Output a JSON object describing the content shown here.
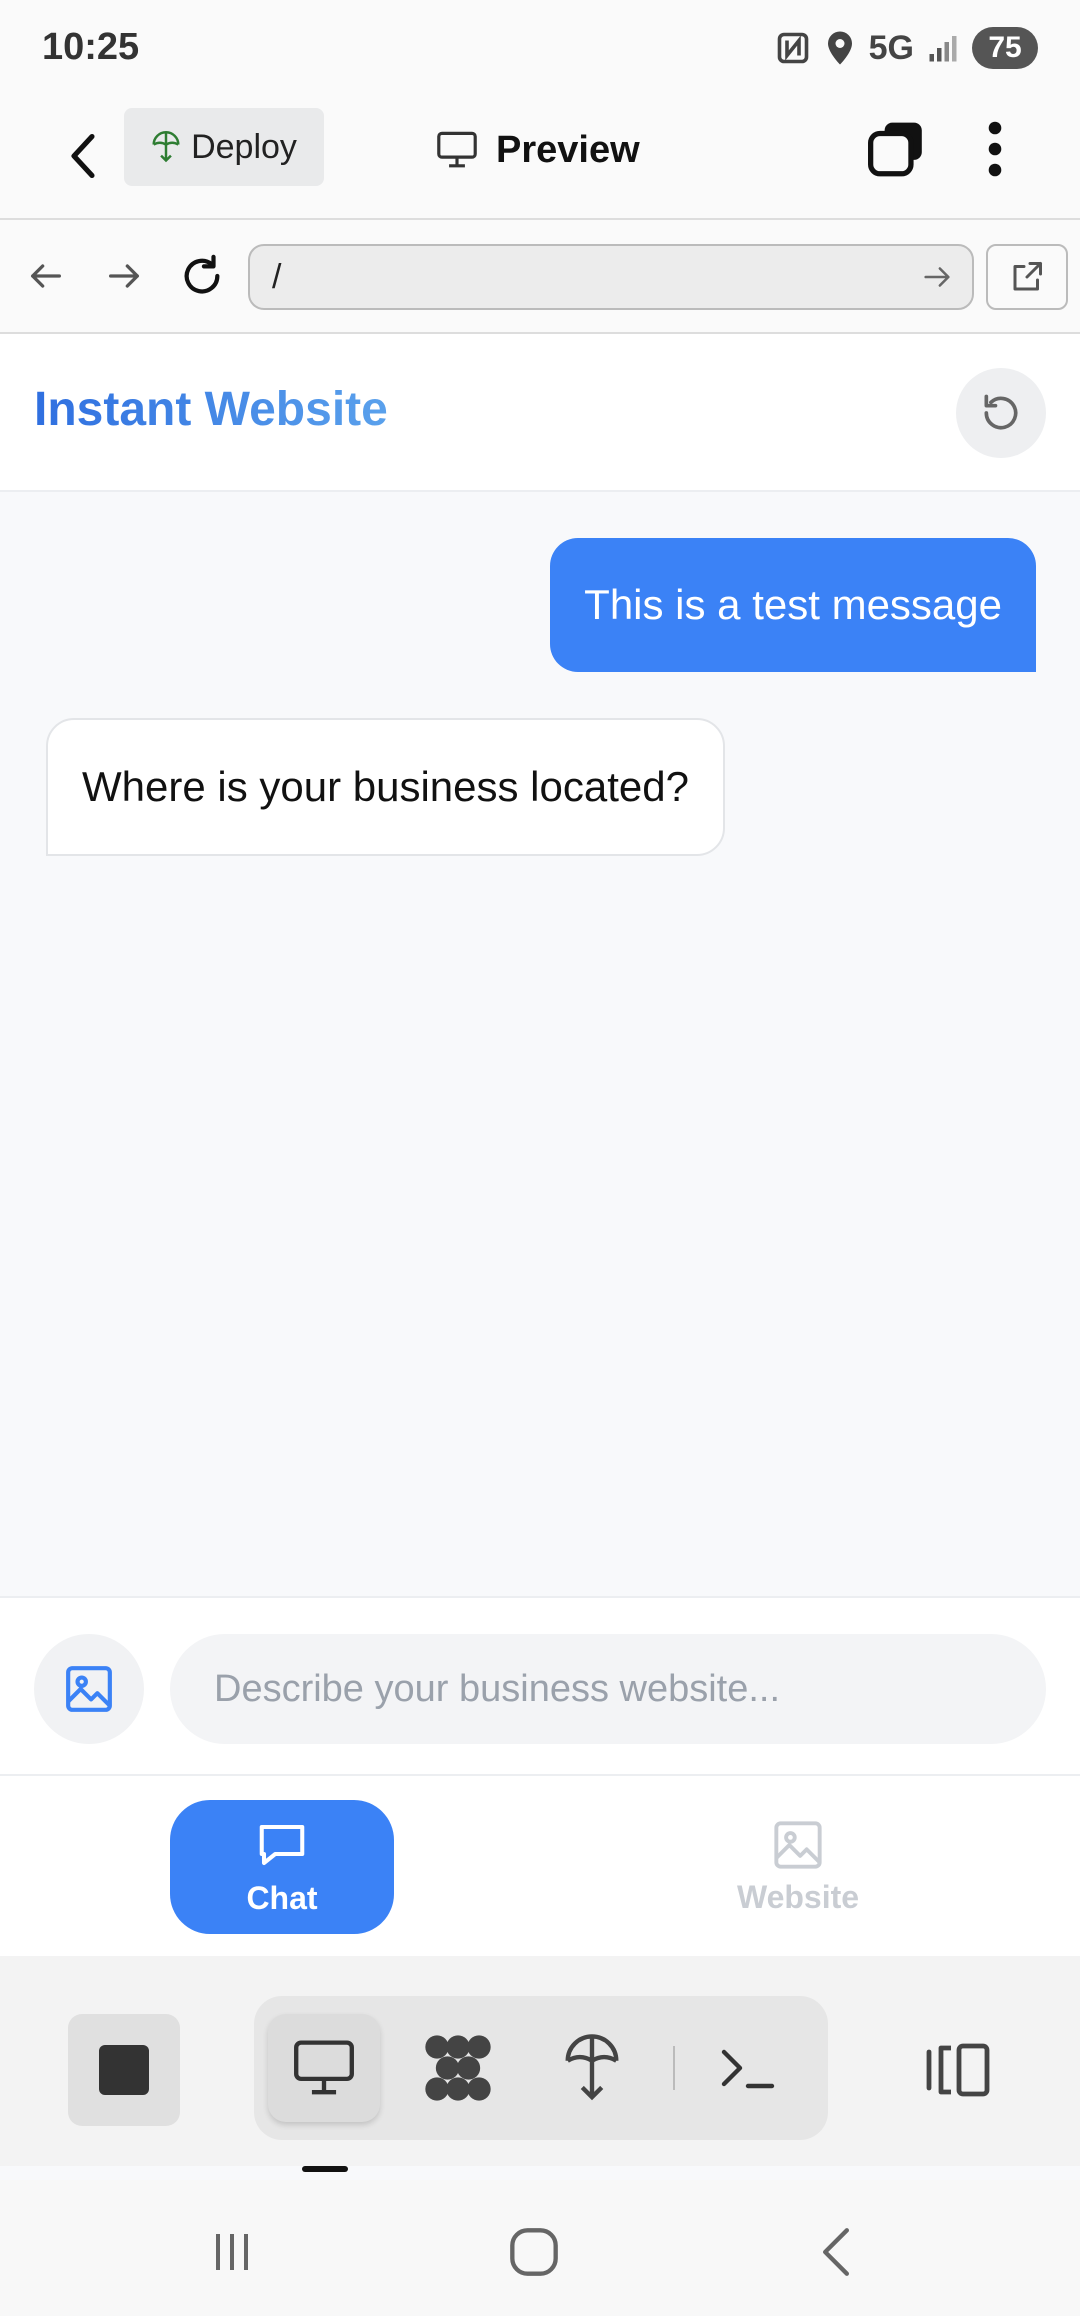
{
  "status_bar": {
    "time": "10:25",
    "network": "5G",
    "battery": "75"
  },
  "top_bar": {
    "deploy_label": "Deploy",
    "title": "Preview"
  },
  "url_bar": {
    "url": "/"
  },
  "app": {
    "title": "Instant Website",
    "messages": [
      {
        "role": "user",
        "text": "This is a test message"
      },
      {
        "role": "assistant",
        "text": "Where is your business located?"
      }
    ],
    "composer": {
      "placeholder": "Describe your business website..."
    },
    "mode_tabs": [
      {
        "label": "Chat",
        "active": true
      },
      {
        "label": "Website",
        "active": false
      }
    ]
  },
  "colors": {
    "accent": "#3b82f6",
    "title_gradient_start": "#2f6fe0",
    "title_gradient_end": "#5aa1ec",
    "deploy_icon": "#2e7d32"
  },
  "icons": {
    "top_bar": [
      "back-arrow-icon",
      "deploy-icon",
      "monitor-icon",
      "tabs-icon",
      "more-vertical-icon"
    ],
    "url_bar": [
      "back-icon",
      "forward-icon",
      "reload-icon",
      "go-arrow-icon",
      "external-link-icon"
    ],
    "bottom_tools": [
      "stop-icon",
      "monitor-icon",
      "apps-icon",
      "deploy-icon",
      "terminal-icon",
      "split-view-icon"
    ],
    "system_nav": [
      "recents-icon",
      "home-icon",
      "back-icon"
    ]
  }
}
